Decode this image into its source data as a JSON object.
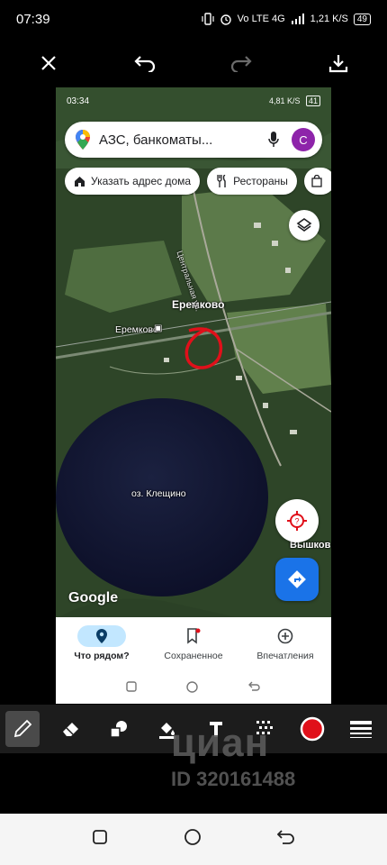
{
  "status": {
    "time": "07:39",
    "network": "Vo LTE 4G",
    "speed": "1,21 K/S",
    "battery": "49"
  },
  "inner_screenshot": {
    "status": {
      "time": "03:34",
      "right": "4,81 K/S",
      "battery": "41"
    },
    "search": {
      "text": "АЗС, банкоматы...",
      "avatar_letter": "С"
    },
    "chips": [
      {
        "label": "Указать адрес дома",
        "icon": "home-icon"
      },
      {
        "label": "Рестораны",
        "icon": "fork-knife-icon"
      }
    ],
    "map_labels": {
      "village": "Еремково",
      "station": "Еремково",
      "street": "Центральная ул.",
      "lake": "оз. Клещино",
      "village2": "Вышков"
    },
    "google_logo": "Google",
    "bottom_nav": [
      {
        "label": "Что рядом?",
        "icon": "pin-icon",
        "active": true
      },
      {
        "label": "Сохраненное",
        "icon": "bookmark-icon",
        "active": false
      },
      {
        "label": "Впечатления",
        "icon": "plus-circle-icon",
        "active": false
      }
    ]
  },
  "watermark": {
    "brand": "циан",
    "id": "ID 320161488"
  },
  "colors": {
    "annotation": "#e0101a",
    "accent": "#1a73e8",
    "avatar": "#8e24aa",
    "nav_active": "#c2e7ff"
  }
}
